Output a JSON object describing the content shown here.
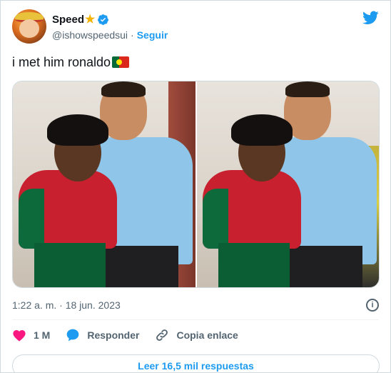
{
  "author": {
    "display_name": "Speed",
    "handle": "@ishowspeedsui",
    "separator": "·",
    "follow_label": "Seguir"
  },
  "tweet": {
    "text": "i met him ronaldo"
  },
  "meta": {
    "timestamp": "1:22 a. m. · 18 jun. 2023",
    "info_glyph": "i"
  },
  "actions": {
    "likes": "1 M",
    "reply_label": "Responder",
    "copy_link_label": "Copia enlace"
  },
  "footer": {
    "read_replies_label": "Leer 16,5 mil respuestas"
  },
  "colors": {
    "accent": "#1d9bf0",
    "like": "#f91880",
    "muted": "#536471",
    "text": "#0f1419",
    "verified": "#1d9bf0",
    "star": "#f5b301"
  },
  "icons": {
    "star": "★",
    "verified": "verified-badge-icon",
    "bird": "twitter-bird-icon",
    "flag": "portugal-flag-icon",
    "heart": "heart-icon",
    "reply": "reply-bubble-icon",
    "link": "link-icon",
    "info": "info-icon"
  }
}
